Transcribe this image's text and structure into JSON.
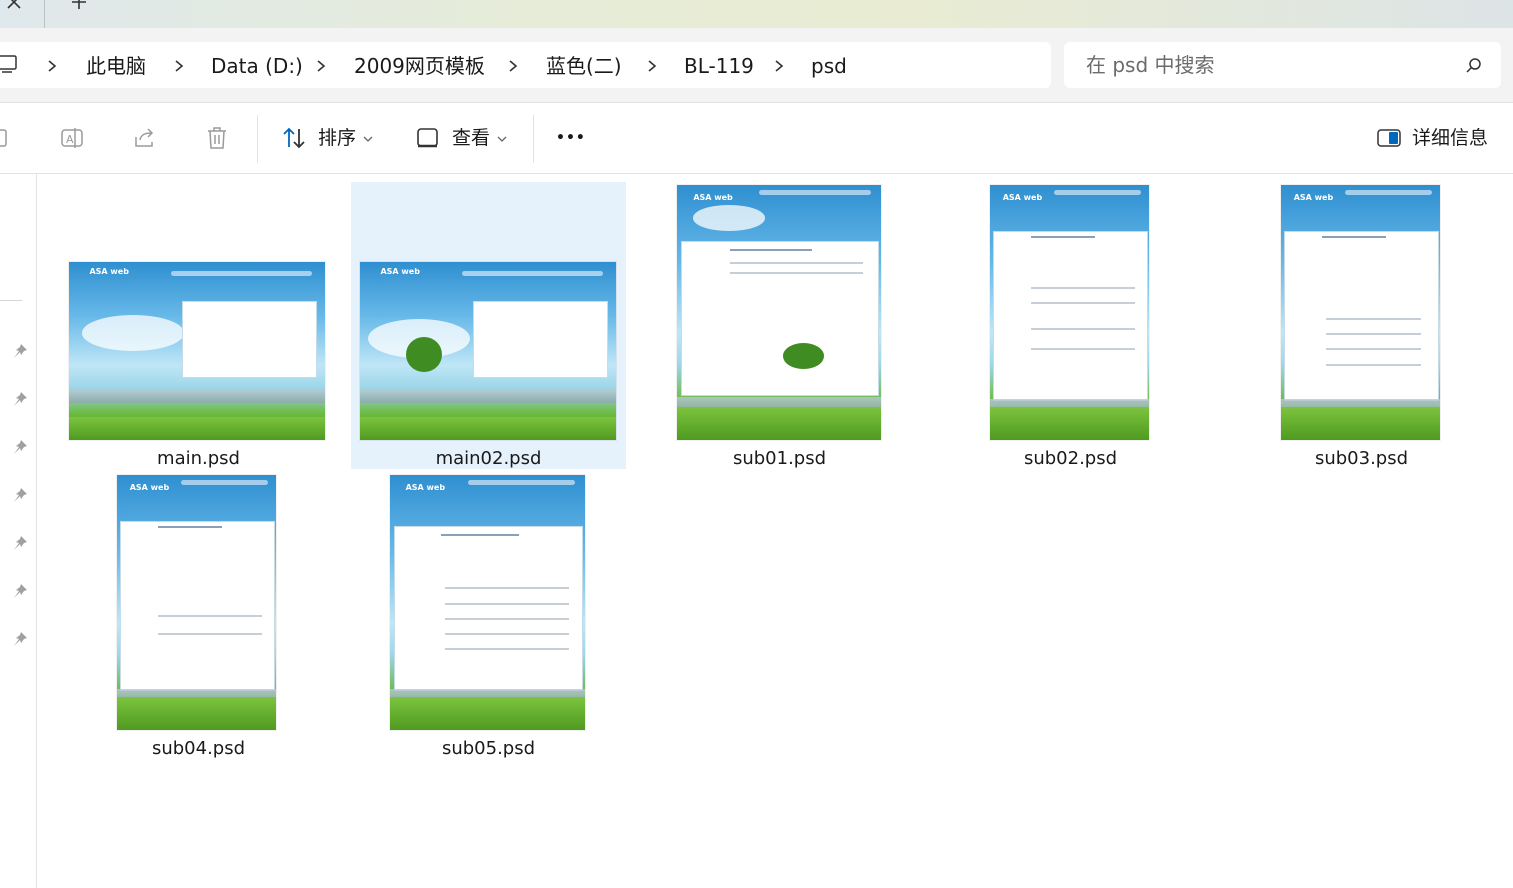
{
  "window": {
    "new_tab_label": "+"
  },
  "breadcrumb": {
    "items": [
      {
        "label": "此电脑"
      },
      {
        "label": "Data (D:)"
      },
      {
        "label": "2009网页模板"
      },
      {
        "label": "蓝色(二)"
      },
      {
        "label": "BL-119"
      },
      {
        "label": "psd"
      }
    ]
  },
  "search": {
    "placeholder": "在 psd 中搜索",
    "value": ""
  },
  "toolbar": {
    "icons": [
      "copy-icon",
      "rename-icon",
      "share-icon",
      "delete-icon"
    ],
    "sort_label": "排序",
    "view_label": "查看",
    "more_label": "•••",
    "details_label": "详细信息"
  },
  "files": [
    {
      "name": "main.psd",
      "selected": false,
      "thumb": {
        "logo": "ASA web"
      }
    },
    {
      "name": "main02.psd",
      "selected": true,
      "thumb": {
        "logo": "ASA web"
      }
    },
    {
      "name": "sub01.psd",
      "selected": false,
      "thumb": {
        "logo": "ASA web",
        "heading": "ABOUT COMPANY"
      }
    },
    {
      "name": "sub02.psd",
      "selected": false,
      "thumb": {
        "logo": "ASA web",
        "heading": "PRODUCT INFORMATION"
      }
    },
    {
      "name": "sub03.psd",
      "selected": false,
      "thumb": {
        "logo": "ASA web",
        "heading": "CUSTOMER CENTER"
      }
    },
    {
      "name": "sub04.psd",
      "selected": false,
      "thumb": {
        "logo": "ASA web",
        "heading": "PRODUCT INFORMATION"
      }
    },
    {
      "name": "sub05.psd",
      "selected": false,
      "thumb": {
        "logo": "ASA web",
        "heading": "COMMUNITY CENTER"
      }
    }
  ],
  "colors": {
    "selection": "#e5f1fb",
    "accent": "#0067c0"
  }
}
